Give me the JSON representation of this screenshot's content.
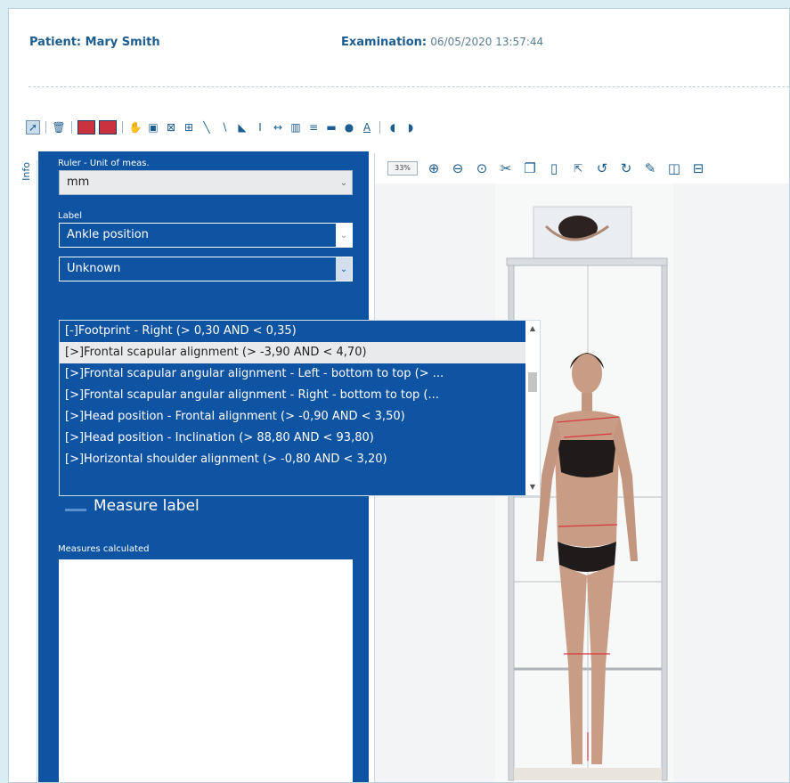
{
  "header": {
    "patient": "Patient: Mary Smith",
    "exam_key": "Examination:",
    "exam_value": "06/05/2020 13:57:44"
  },
  "toolbar_icons": [
    "pointer-icon",
    "trash-icon",
    "rect-red-icon",
    "rect-red-outline-icon",
    "hand-icon",
    "image-icon",
    "crop-icon",
    "measure-tool-icon",
    "line-icon",
    "angle-icon",
    "right-angle-icon",
    "vertical-measure-icon",
    "horizontal-measure-icon",
    "grid-icon",
    "lines-icon",
    "bar-icon",
    "ellipse-icon",
    "text-icon",
    "left-foot-icon",
    "right-foot-icon"
  ],
  "side_tab": {
    "label": "Info"
  },
  "panel": {
    "ruler_label": "Ruler - Unit of meas.",
    "unit_value": "mm",
    "label_caption": "Label",
    "label_value": "Ankle position",
    "label2_value": "Unknown",
    "measure_label_button": "Measure label",
    "measures_caption": "Measures calculated"
  },
  "dropdown_options": [
    "[-]Footprint - Right (> 0,30 AND < 0,35)",
    "[>]Frontal scapular alignment (> -3,90 AND < 4,70)",
    "[>]Frontal scapular angular alignment - Left - bottom to top (> ...",
    "[>]Frontal scapular angular alignment - Right - bottom to top (...",
    "[>]Head position - Frontal alignment (> -0,90 AND < 3,50)",
    "[>]Head position - Inclination (> 88,80 AND < 93,80)",
    "[>]Horizontal shoulder alignment (> -0,80 AND < 3,20)"
  ],
  "selected_option_index": 1,
  "viewer": {
    "zoom": "33%"
  },
  "colors": {
    "brand_blue": "#0f53a3",
    "header_blue": "#1d5d8f",
    "accent_red": "#d9363e"
  }
}
